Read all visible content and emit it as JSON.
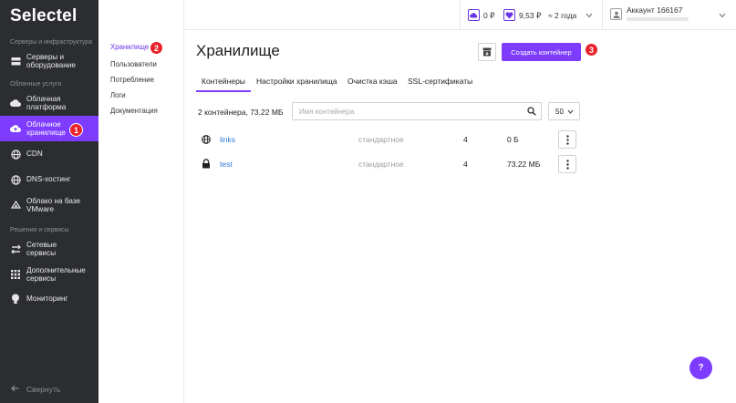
{
  "brand": {
    "logo": "Selectel"
  },
  "sidebar": {
    "sections": [
      {
        "title": "Серверы и инфраструктура"
      },
      {
        "title": "Облачные услуги"
      },
      {
        "title": "Решения и сервисы"
      }
    ],
    "items": [
      {
        "label_l1": "Серверы и",
        "label_l2": "оборудование",
        "icon": "server-icon"
      },
      {
        "label_l1": "Облачная",
        "label_l2": "платформа",
        "icon": "cloud-platform-icon"
      },
      {
        "label_l1": "Облачное",
        "label_l2": "хранилище",
        "icon": "cloud-storage-icon",
        "active": true
      },
      {
        "label_l1": "CDN",
        "label_l2": "",
        "icon": "globe-icon"
      },
      {
        "label_l1": "DNS-хостинг",
        "label_l2": "",
        "icon": "dns-icon"
      },
      {
        "label_l1": "Облако на базе",
        "label_l2": "VMware",
        "icon": "vmware-icon"
      },
      {
        "label_l1": "Сетевые",
        "label_l2": "сервисы",
        "icon": "network-icon"
      },
      {
        "label_l1": "Дополнительные",
        "label_l2": "сервисы",
        "icon": "grid-icon"
      },
      {
        "label_l1": "Мониторинг",
        "label_l2": "",
        "icon": "bulb-icon"
      }
    ],
    "collapse_label": "Свернуть"
  },
  "badges": {
    "b1": "1",
    "b2": "2",
    "b3": "3"
  },
  "submenu": {
    "items": [
      "Хранилище",
      "Пользователи",
      "Потребление",
      "Логи",
      "Документация"
    ]
  },
  "topbar": {
    "balance_storage": "0 ₽",
    "balance_main": "9,53 ₽",
    "period": "≈ 2 года",
    "account": "Аккаунт 166167"
  },
  "main": {
    "title": "Хранилище",
    "create_button": "Создать контейнер",
    "tabs": [
      "Контейнеры",
      "Настройки хранилища",
      "Очистка кэша",
      "SSL-сертификаты"
    ],
    "summary": "2 контейнера, 73.22 МБ",
    "search_placeholder": "Имя контейнера",
    "page_size": "50",
    "containers": [
      {
        "name": "links",
        "type": "стандартное",
        "objects": "4",
        "size": "0 Б",
        "icon": "globe-icon"
      },
      {
        "name": "test",
        "type": "стандартное",
        "objects": "4",
        "size": "73.22 МБ",
        "icon": "lock-icon"
      }
    ]
  },
  "help_label": "?",
  "colors": {
    "accent": "#7d3cff",
    "sidebar_bg": "#2b2d30",
    "link": "#2c7bd8",
    "badge": "#e8222b"
  }
}
